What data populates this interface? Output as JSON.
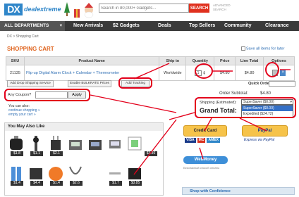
{
  "header": {
    "logo": "DX",
    "logo_text": "dealextreme",
    "search_placeholder": "Search in 80,000+ Gadgets...",
    "search_button": "SEARCH",
    "advanced_search": "ADVANCED SEARCH"
  },
  "nav": {
    "all_departments": "ALL DEPARTMENTS",
    "caret": "▾",
    "items": [
      "New Arrivals",
      "$2 Gadgets",
      "Deals",
      "Top Sellers",
      "Community",
      "Clearance"
    ]
  },
  "breadcrumb": "DX > Shopping Cart",
  "cart": {
    "title": "SHOPPING CART",
    "save_later": "Save all items for later",
    "columns": [
      "SKU",
      "Product Name",
      "Ship to",
      "Quantity",
      "Price",
      "Line Total",
      "Options"
    ],
    "rows": [
      {
        "sku": "21135",
        "name": "Flip-up Digital Alarm Clock + Calendar + Thermometer",
        "ship_to": "Worldwide",
        "quantity": "1",
        "price": "$4.80",
        "line_total": "$4.80"
      }
    ],
    "qty_up": "▲",
    "qty_down": "▼",
    "remove_icon": "×"
  },
  "actions": {
    "drop_shipping": "Add Drop Shipping Service",
    "bulk_rate": "Enable BULKRATE Prices",
    "add_tracking": "Add Tracking",
    "quick_order": "Quick Order:"
  },
  "coupon": {
    "label": "Any Coupon?",
    "apply": "Apply",
    "also_can": "You can also:",
    "continue": "continue shopping »",
    "empty": "empty your cart »"
  },
  "totals": {
    "subtotal_label": "Order Subtotal:",
    "subtotal_value": "$4.80",
    "shipping_label": "Shipping (Estimated):",
    "shipping_selected": "SuperSaver ($0.00)",
    "shipping_options": [
      "SuperSaver ($0.00)",
      "Expedited ($24.72)"
    ],
    "grand_total_label": "Grand Total:",
    "caret": "▾"
  },
  "payment": {
    "checkout_cc": "Credit Card",
    "checkout_paypal": "PayPal",
    "cards": [
      "VISA",
      "MC",
      "AMEX"
    ],
    "express": "Express via PayPal",
    "webmoney": "WebMoney",
    "webmoney_note": "Безопасный способ оплаты"
  },
  "recommend": {
    "title": "You May Also Like",
    "prices": [
      "$1.8",
      "$1.1",
      "$2.1",
      "",
      "",
      "",
      "$3.36",
      "$1.4",
      "$4.4",
      "$1.4",
      "$2.6",
      "$1.7",
      "$3.85"
    ]
  },
  "confidence": "Shop with Confidence",
  "colors": {
    "accent_orange": "#e0641e",
    "search_red": "#e0301e",
    "nav_dark": "#3a3a3a",
    "link_blue": "#2f6fb4",
    "annotation_red": "#e3001b"
  }
}
